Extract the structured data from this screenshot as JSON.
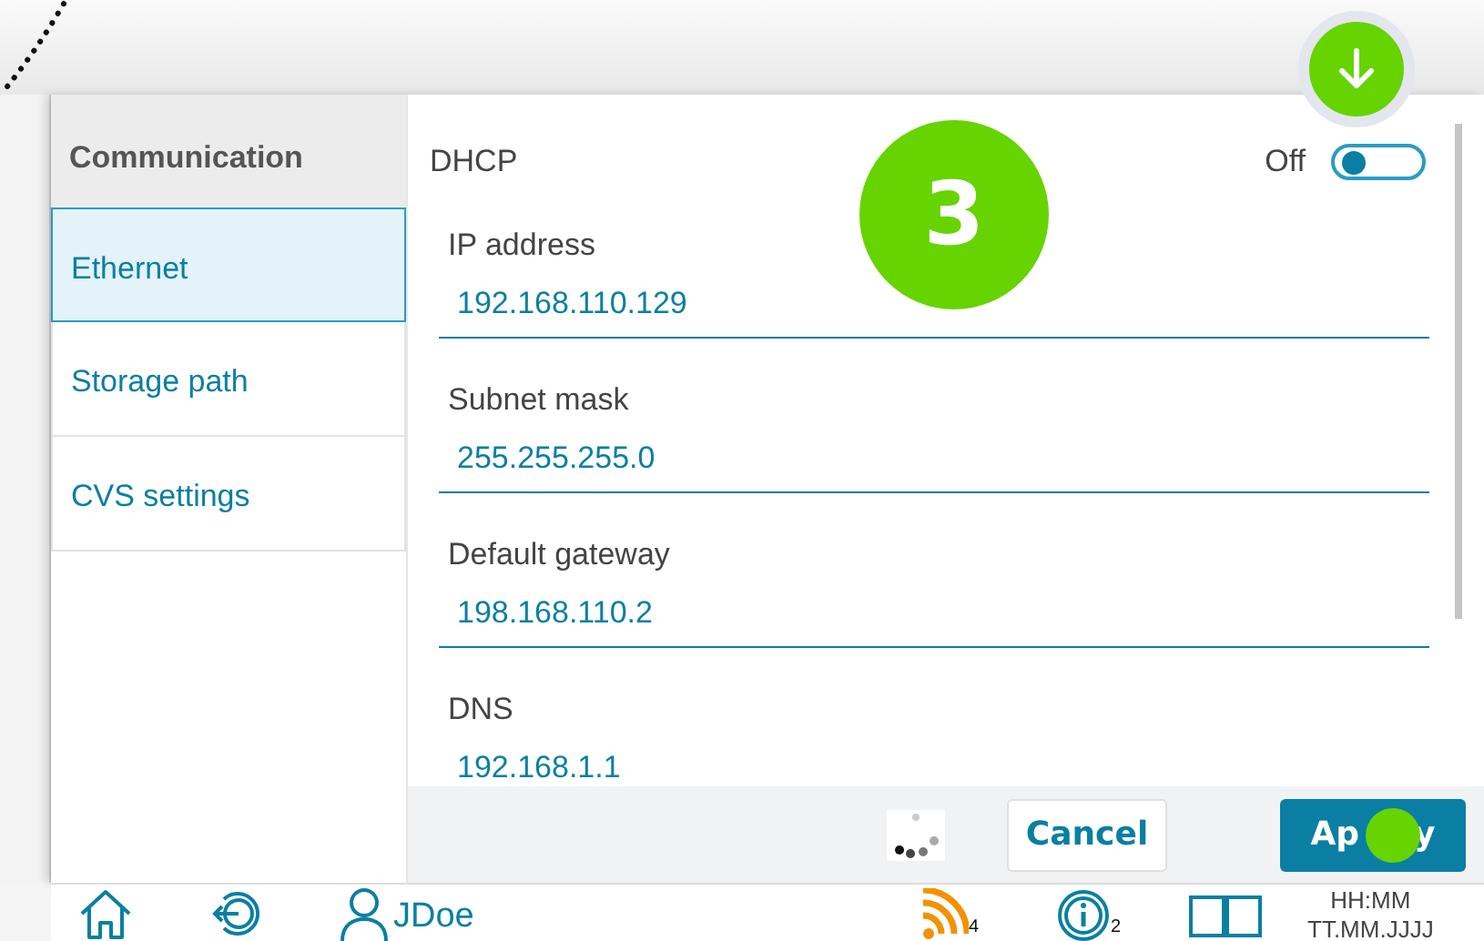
{
  "sidebar": {
    "header": "Communication",
    "items": [
      {
        "label": "Ethernet",
        "selected": true
      },
      {
        "label": "Storage path",
        "selected": false
      },
      {
        "label": "CVS settings",
        "selected": false
      }
    ]
  },
  "dhcp": {
    "label": "DHCP",
    "state_label": "Off",
    "on": false
  },
  "step_badge": "3",
  "fields": [
    {
      "label": "IP address",
      "value": "192.168.110.129"
    },
    {
      "label": "Subnet mask",
      "value": "255.255.255.0"
    },
    {
      "label": "Default gateway",
      "value": "198.168.110.2"
    },
    {
      "label": "DNS",
      "value": "192.168.1.1"
    }
  ],
  "actions": [
    {
      "label": "Cancel",
      "kind": "secondary"
    },
    {
      "label_parts": [
        "Ap",
        "y"
      ],
      "kind": "primary"
    }
  ],
  "taskbar": {
    "user": "JDoe",
    "indicators": [
      {
        "kind": "wifi",
        "count": "4"
      },
      {
        "kind": "info",
        "count": "2"
      }
    ],
    "time": "HH:MM",
    "date": "TT.MM.JJJJ"
  }
}
